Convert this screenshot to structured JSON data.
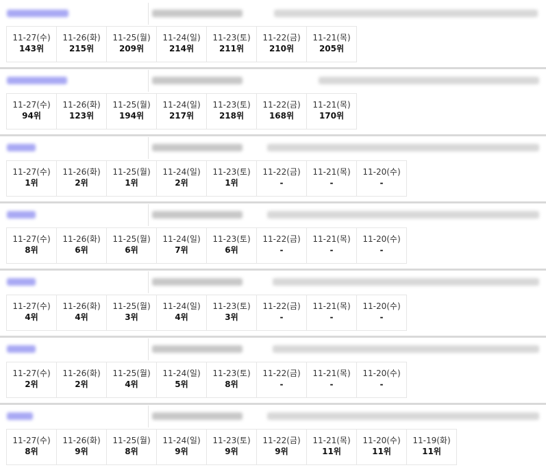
{
  "colors": {
    "link": "#8c8cf0",
    "separator": "#d9d9d9",
    "border": "#e6e6e6"
  },
  "items": [
    {
      "days": [
        {
          "date": "11-27(수)",
          "rank": "143위"
        },
        {
          "date": "11-26(화)",
          "rank": "215위"
        },
        {
          "date": "11-25(월)",
          "rank": "209위"
        },
        {
          "date": "11-24(일)",
          "rank": "214위"
        },
        {
          "date": "11-23(토)",
          "rank": "211위"
        },
        {
          "date": "11-22(금)",
          "rank": "210위"
        },
        {
          "date": "11-21(목)",
          "rank": "205위"
        }
      ]
    },
    {
      "days": [
        {
          "date": "11-27(수)",
          "rank": "94위"
        },
        {
          "date": "11-26(화)",
          "rank": "123위"
        },
        {
          "date": "11-25(월)",
          "rank": "194위"
        },
        {
          "date": "11-24(일)",
          "rank": "217위"
        },
        {
          "date": "11-23(토)",
          "rank": "218위"
        },
        {
          "date": "11-22(금)",
          "rank": "168위"
        },
        {
          "date": "11-21(목)",
          "rank": "170위"
        }
      ]
    },
    {
      "days": [
        {
          "date": "11-27(수)",
          "rank": "1위"
        },
        {
          "date": "11-26(화)",
          "rank": "2위"
        },
        {
          "date": "11-25(월)",
          "rank": "1위"
        },
        {
          "date": "11-24(일)",
          "rank": "2위"
        },
        {
          "date": "11-23(토)",
          "rank": "1위"
        },
        {
          "date": "11-22(금)",
          "rank": "-"
        },
        {
          "date": "11-21(목)",
          "rank": "-"
        },
        {
          "date": "11-20(수)",
          "rank": "-"
        }
      ]
    },
    {
      "days": [
        {
          "date": "11-27(수)",
          "rank": "8위"
        },
        {
          "date": "11-26(화)",
          "rank": "6위"
        },
        {
          "date": "11-25(월)",
          "rank": "6위"
        },
        {
          "date": "11-24(일)",
          "rank": "7위"
        },
        {
          "date": "11-23(토)",
          "rank": "6위"
        },
        {
          "date": "11-22(금)",
          "rank": "-"
        },
        {
          "date": "11-21(목)",
          "rank": "-"
        },
        {
          "date": "11-20(수)",
          "rank": "-"
        }
      ]
    },
    {
      "days": [
        {
          "date": "11-27(수)",
          "rank": "4위"
        },
        {
          "date": "11-26(화)",
          "rank": "4위"
        },
        {
          "date": "11-25(월)",
          "rank": "3위"
        },
        {
          "date": "11-24(일)",
          "rank": "4위"
        },
        {
          "date": "11-23(토)",
          "rank": "3위"
        },
        {
          "date": "11-22(금)",
          "rank": "-"
        },
        {
          "date": "11-21(목)",
          "rank": "-"
        },
        {
          "date": "11-20(수)",
          "rank": "-"
        }
      ]
    },
    {
      "days": [
        {
          "date": "11-27(수)",
          "rank": "2위"
        },
        {
          "date": "11-26(화)",
          "rank": "2위"
        },
        {
          "date": "11-25(월)",
          "rank": "4위"
        },
        {
          "date": "11-24(일)",
          "rank": "5위"
        },
        {
          "date": "11-23(토)",
          "rank": "8위"
        },
        {
          "date": "11-22(금)",
          "rank": "-"
        },
        {
          "date": "11-21(목)",
          "rank": "-"
        },
        {
          "date": "11-20(수)",
          "rank": "-"
        }
      ]
    },
    {
      "days": [
        {
          "date": "11-27(수)",
          "rank": "8위"
        },
        {
          "date": "11-26(화)",
          "rank": "9위"
        },
        {
          "date": "11-25(월)",
          "rank": "8위"
        },
        {
          "date": "11-24(일)",
          "rank": "9위"
        },
        {
          "date": "11-23(토)",
          "rank": "9위"
        },
        {
          "date": "11-22(금)",
          "rank": "9위"
        },
        {
          "date": "11-21(목)",
          "rank": "11위"
        },
        {
          "date": "11-20(수)",
          "rank": "11위"
        },
        {
          "date": "11-19(화)",
          "rank": "11위"
        }
      ]
    }
  ]
}
